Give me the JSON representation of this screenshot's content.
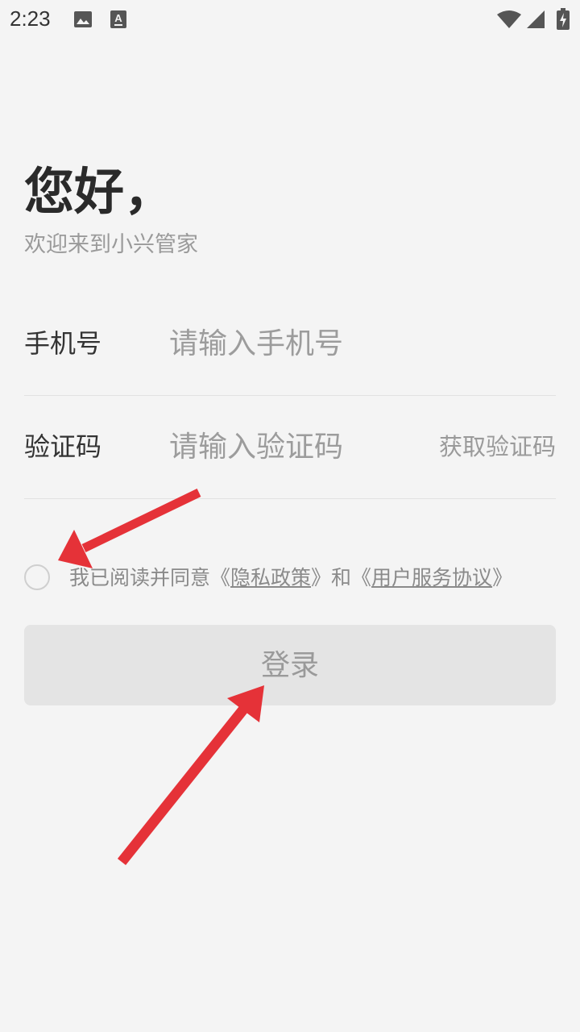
{
  "status_bar": {
    "time": "2:23",
    "icons": [
      "image-icon",
      "text-a-icon",
      "wifi-icon",
      "signal-icon",
      "battery-charging-icon"
    ]
  },
  "greeting": {
    "title": "您好，",
    "subtitle": "欢迎来到小兴管家"
  },
  "form": {
    "phone": {
      "label": "手机号",
      "value": "",
      "placeholder": "请输入手机号"
    },
    "code": {
      "label": "验证码",
      "value": "",
      "placeholder": "请输入验证码",
      "get_code_label": "获取验证码"
    }
  },
  "agreement": {
    "checked": false,
    "prefix": "我已阅读并同意《",
    "privacy_label": "隐私政策",
    "middle": "》和《",
    "terms_label": "用户服务协议",
    "suffix": "》"
  },
  "login_button": {
    "label": "登录"
  },
  "colors": {
    "background": "#f4f4f4",
    "button_bg": "#e4e4e4",
    "annotation_arrow": "#e53238"
  }
}
